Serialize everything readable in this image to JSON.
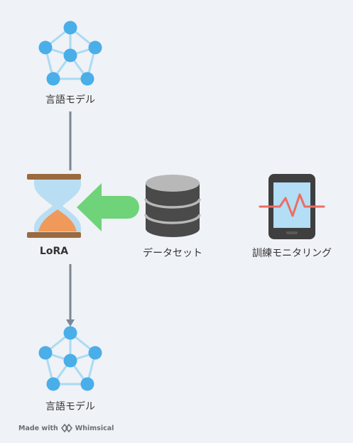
{
  "nodes": {
    "top_model": {
      "label": "言語モデル"
    },
    "lora": {
      "label": "LoRA"
    },
    "dataset": {
      "label": "データセット"
    },
    "monitoring": {
      "label": "訓練モニタリング"
    },
    "bottom_model": {
      "label": "言語モデル"
    }
  },
  "footer": {
    "made_with": "Made with",
    "brand": "Whimsical"
  },
  "colors": {
    "node_blue": "#4aaee9",
    "edge_light_blue": "#aadbf4",
    "arrow_green": "#6fd37a",
    "connector_gray": "#7b8794",
    "hourglass_bar": "#9b6a3e",
    "hourglass_glass": "#b9def4",
    "hourglass_sand": "#ef9a5a",
    "database_dark": "#4a4a4a",
    "database_light": "#b8b8b8",
    "phone_body": "#3f3f3f",
    "phone_screen": "#b3def5",
    "pulse_red": "#ec6d63"
  }
}
